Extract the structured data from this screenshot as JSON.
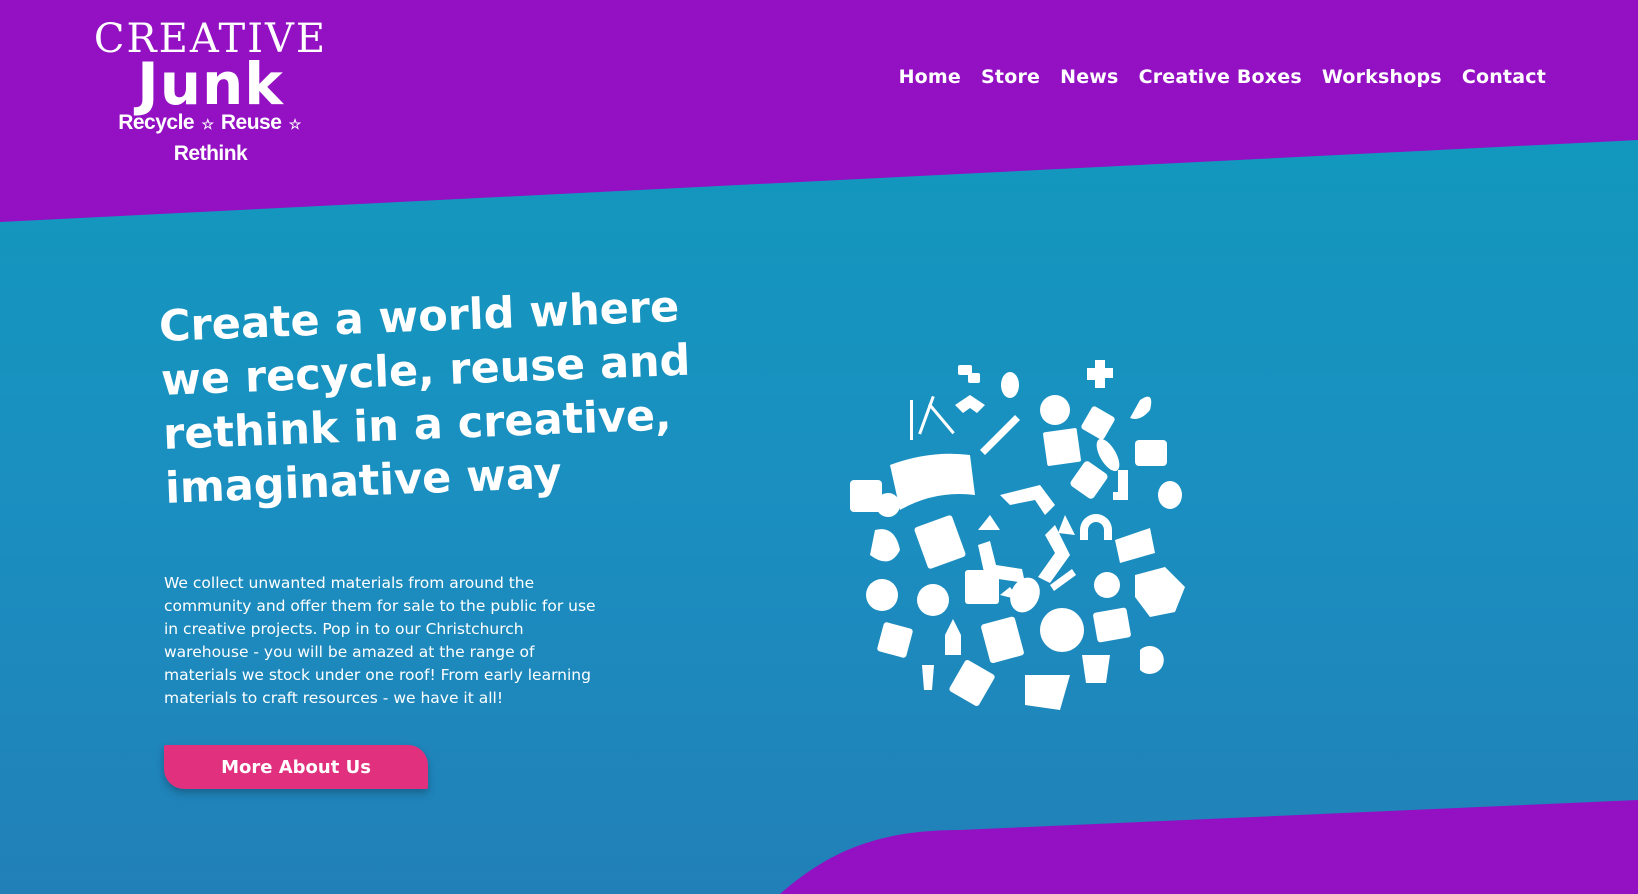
{
  "colors": {
    "purple": "#9311c2",
    "teal_top": "#0f9bbd",
    "teal_bottom": "#2180b8",
    "cta_pink": "#e0307e",
    "white": "#ffffff"
  },
  "logo": {
    "line1": "CREATIVE",
    "line2": "Junk",
    "tagline_parts": [
      "Recycle",
      "Reuse",
      "Rethink"
    ],
    "star_glyph": "☆"
  },
  "nav": {
    "items": [
      {
        "label": "Home"
      },
      {
        "label": "Store"
      },
      {
        "label": "News"
      },
      {
        "label": "Creative Boxes"
      },
      {
        "label": "Workshops"
      },
      {
        "label": "Contact"
      }
    ]
  },
  "hero": {
    "title": "Create a world where we recycle, reuse and rethink in a creative, imaginative way",
    "body": "We collect unwanted materials from around the community and offer them for sale to the public for use in creative projects. Pop in to our Christchurch warehouse - you will be amazed at the range of materials we stock under one roof! From early learning materials to craft resources - we have it all!",
    "cta_label": "More About Us"
  },
  "illustration": {
    "icon": "recycled-materials-cloud-icon"
  }
}
